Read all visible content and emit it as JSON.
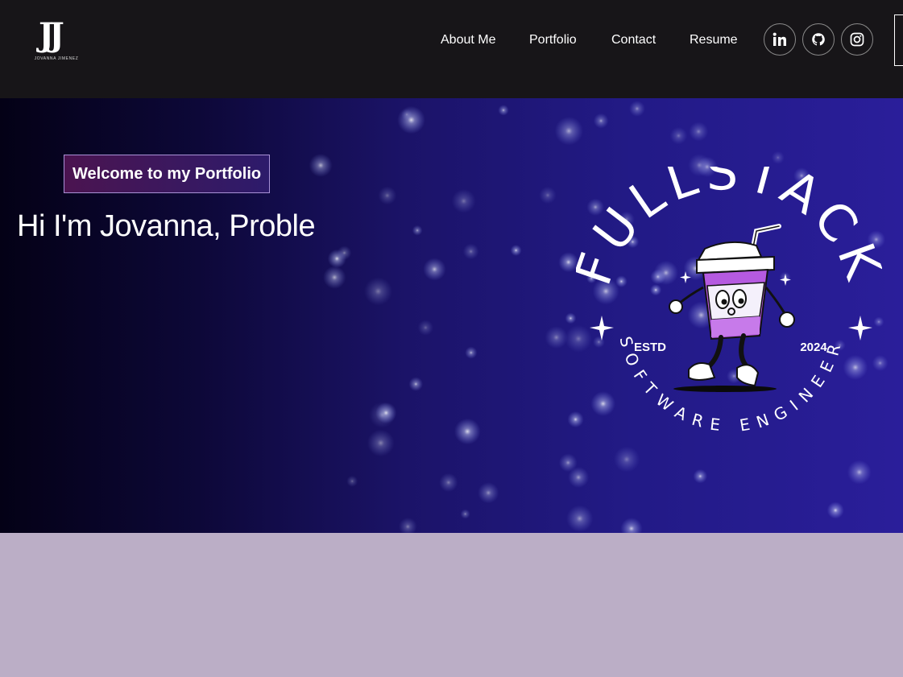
{
  "brand": {
    "monogram": "JJ",
    "name": "JOVANNA JIMENEZ"
  },
  "nav": {
    "links": [
      {
        "label": "About Me"
      },
      {
        "label": "Portfolio"
      },
      {
        "label": "Contact"
      },
      {
        "label": "Resume"
      }
    ],
    "social": [
      {
        "name": "linkedin-icon"
      },
      {
        "name": "github-icon"
      },
      {
        "name": "instagram-icon"
      }
    ]
  },
  "banner": {
    "tagline": "Welcome to my Portfolio",
    "headline": "Hi I'm Jovanna, Proble",
    "badge": {
      "top_text": "FULLSTACK",
      "bottom_text": "SOFTWARE ENGINEER",
      "left_text": "ESTD",
      "right_text": "2024"
    }
  },
  "colors": {
    "navbar": "#171518",
    "banner_dark": "#040116",
    "banner_light": "#2a1e9a",
    "accent_purple": "#a992d6",
    "cup_purple": "#b55ae0",
    "lower_section": "#bbaec6"
  }
}
